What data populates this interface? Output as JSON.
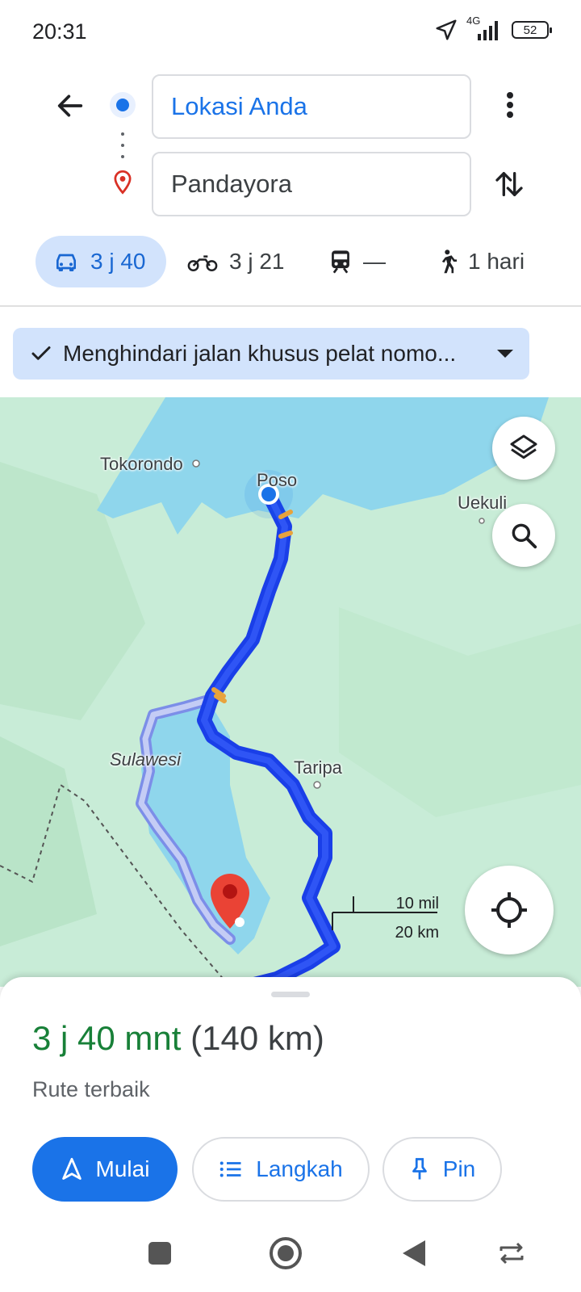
{
  "status": {
    "time": "20:31",
    "network": "4G",
    "battery": "52"
  },
  "search": {
    "origin": "Lokasi Anda",
    "destination": "Pandayora"
  },
  "modes": [
    {
      "name": "drive",
      "label": "3 j 40",
      "icon": "car-icon",
      "selected": true
    },
    {
      "name": "motorcycle",
      "label": "3 j 21",
      "icon": "motorcycle-icon"
    },
    {
      "name": "transit",
      "label": "—",
      "icon": "train-icon"
    },
    {
      "name": "walk",
      "label": "1 hari",
      "icon": "walk-icon"
    }
  ],
  "avoid_chip": {
    "label": "Menghindari jalan khusus pelat nomo..."
  },
  "map": {
    "labels": {
      "tokorondo": "Tokorondo",
      "poso": "Poso",
      "uekuli": "Uekuli",
      "sulawesi": "Sulawesi",
      "taripa": "Taripa"
    },
    "scale": {
      "miles": "10 mil",
      "km": "20 km"
    },
    "colors": {
      "land": "#c8ecd7",
      "water": "#8fd6ec",
      "route": "#1a3fe8",
      "alt_route": "#a8b4f0",
      "traffic": "#e8a33c"
    }
  },
  "sheet": {
    "duration": "3 j 40 mnt",
    "distance": "(140 km)",
    "subtitle": "Rute terbaik",
    "start_label": "Mulai",
    "steps_label": "Langkah",
    "pin_label": "Pin"
  }
}
